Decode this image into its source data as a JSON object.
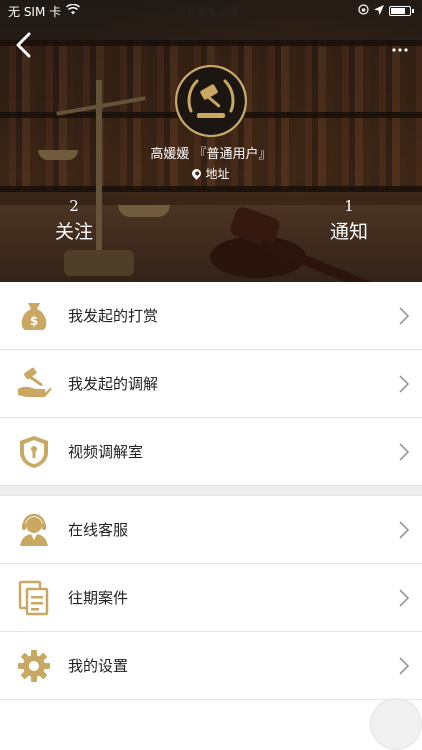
{
  "status_bar": {
    "carrier": "无 SIM 卡",
    "time": "下午5:45",
    "icons": [
      "wifi-icon",
      "orientation-lock-icon",
      "location-icon",
      "battery-icon"
    ]
  },
  "header": {
    "back_icon": "chevron-left-icon",
    "more_icon": "more-dots-icon",
    "avatar_icon": "gavel-laurel-icon",
    "user_name": "高媛媛 『普通用户』",
    "address_icon": "map-pin-icon",
    "address": "地址",
    "stats": {
      "follow": {
        "count": "2",
        "label": "关注"
      },
      "notify": {
        "count": "1",
        "label": "通知"
      }
    }
  },
  "menu": {
    "group1": [
      {
        "label": "我发起的打赏",
        "icon": "money-bag-icon"
      },
      {
        "label": "我发起的调解",
        "icon": "gavel-hand-icon"
      },
      {
        "label": "视频调解室",
        "icon": "shield-keyhole-icon"
      }
    ],
    "group2": [
      {
        "label": "在线客服",
        "icon": "customer-service-icon"
      },
      {
        "label": "往期案件",
        "icon": "documents-icon"
      },
      {
        "label": "我的设置",
        "icon": "gear-icon"
      }
    ]
  },
  "colors": {
    "accent_gold": "#c9a863",
    "divider": "#e4e4e4",
    "section_gap": "#eeeeee"
  }
}
